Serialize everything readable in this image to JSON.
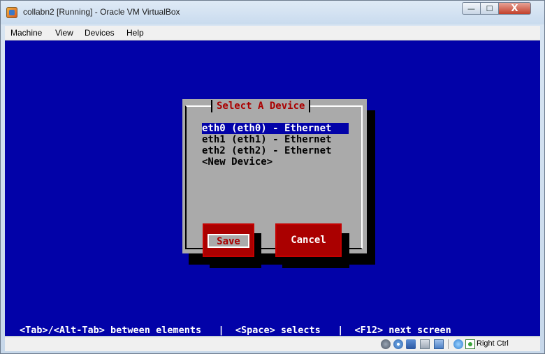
{
  "window": {
    "title": "collabn2 [Running] - Oracle VM VirtualBox",
    "buttons": {
      "minimize": "—",
      "maximize": "☐",
      "close": "X"
    }
  },
  "menubar": {
    "items": [
      "Machine",
      "View",
      "Devices",
      "Help"
    ]
  },
  "dialog": {
    "title": "Select A Device",
    "devices": [
      "eth0 (eth0) - Ethernet",
      "eth1 (eth1) - Ethernet",
      "eth2 (eth2) - Ethernet",
      "<New Device>"
    ],
    "selected_index": 0,
    "save_label": "Save",
    "cancel_label": "Cancel"
  },
  "vm_help_line": "<Tab>/<Alt-Tab> between elements   |  <Space> selects   |  <F12> next screen",
  "statusbar": {
    "icons": [
      "hard-disk-icon",
      "optical-drive-icon",
      "network-icon",
      "usb-icon",
      "shared-folders-icon",
      "mouse-integration-icon",
      "keyboard-capture-icon"
    ],
    "host_key": "Right Ctrl"
  },
  "colors": {
    "vm_background": "#0202a8",
    "dialog_gray": "#aaaaaa",
    "button_red": "#aa0000",
    "title_red": "#aa0000"
  }
}
